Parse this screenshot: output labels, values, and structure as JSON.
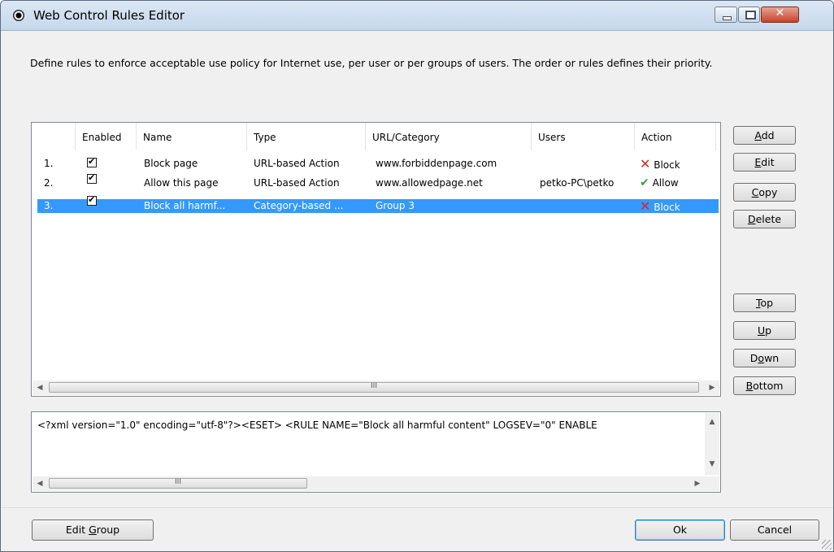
{
  "window": {
    "title": "Web Control Rules Editor",
    "close_glyph": "✕",
    "description": "Define rules to enforce acceptable use policy for Internet use, per user or per groups of users. The order or rules defines their priority."
  },
  "columns": [
    "Enabled",
    "Name",
    "Type",
    "URL/Category",
    "Users",
    "Action"
  ],
  "rules": [
    {
      "num": "1.",
      "enabled": true,
      "name": "Block page",
      "type": "URL-based Action",
      "url": "www.forbiddenpage.com",
      "users": "",
      "action": "Block",
      "action_icon": "x-icon",
      "selected": false
    },
    {
      "num": "2.",
      "enabled": true,
      "name": "Allow this page",
      "type": "URL-based Action",
      "url": "www.allowedpage.net",
      "users": "petko-PC\\petko",
      "action": "Allow",
      "action_icon": "check-icon",
      "selected": false
    },
    {
      "num": "3.",
      "enabled": true,
      "name": "Block all harmf...",
      "type": "Category-based ...",
      "url": "Group 3",
      "users": "",
      "action": "Block",
      "action_icon": "x-icon",
      "selected": true
    }
  ],
  "side_buttons": {
    "add": {
      "pre": "",
      "key": "A",
      "post": "dd"
    },
    "edit": {
      "pre": "",
      "key": "E",
      "post": "dit"
    },
    "copy": {
      "pre": "",
      "key": "C",
      "post": "opy"
    },
    "delete": {
      "pre": "",
      "key": "D",
      "post": "elete"
    },
    "top": {
      "pre": "",
      "key": "T",
      "post": "op"
    },
    "up": {
      "pre": "",
      "key": "U",
      "post": "p"
    },
    "down": {
      "pre": "D",
      "key": "o",
      "post": "wn"
    },
    "bottom": {
      "pre": "",
      "key": "B",
      "post": "ottom"
    }
  },
  "xml_preview": "<?xml version=\"1.0\" encoding=\"utf-8\"?><ESET> <RULE NAME=\"Block all harmful content\" LOGSEV=\"0\" ENABLE",
  "scrollbar": {
    "thumb_grip": "III",
    "left_arrow": "◀",
    "right_arrow": "▶",
    "up_arrow": "▲",
    "down_arrow": "▼"
  },
  "footer": {
    "edit_group": {
      "pre": "Edit ",
      "key": "G",
      "post": "roup"
    },
    "ok": "Ok",
    "cancel": "Cancel"
  },
  "colors": {
    "selection": "#3399ff",
    "block": "#e02222",
    "allow": "#3ea134"
  }
}
